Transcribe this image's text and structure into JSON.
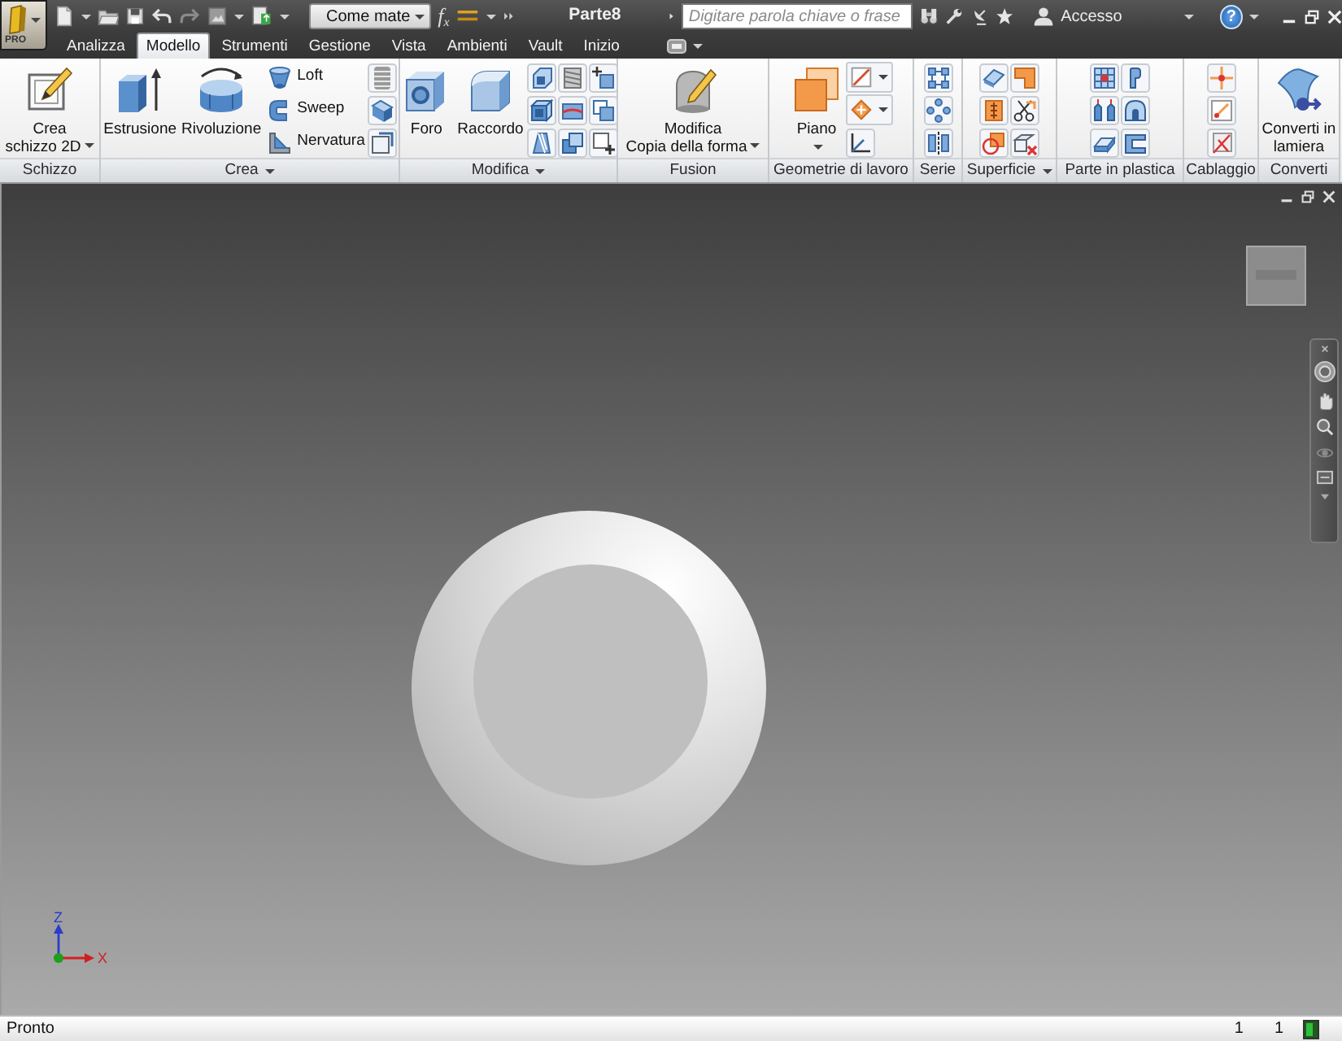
{
  "title_bar": {
    "app_edition": "PRO",
    "style_dropdown": "Come mate",
    "parameters": "f$_{x}$",
    "document_title": "Parte8",
    "search": {
      "placeholder": "Digitare parola chiave o frase"
    },
    "sign_in": "Accesso",
    "help": "?"
  },
  "tabs": [
    {
      "label": "Analizza",
      "selected": false
    },
    {
      "label": "Modello",
      "selected": true
    },
    {
      "label": "Strumenti",
      "selected": false
    },
    {
      "label": "Gestione",
      "selected": false
    },
    {
      "label": "Vista",
      "selected": false
    },
    {
      "label": "Ambienti",
      "selected": false
    },
    {
      "label": "Vault",
      "selected": false
    },
    {
      "label": "Inizio",
      "selected": false
    }
  ],
  "ribbon": {
    "panels": [
      {
        "title": "Schizzo",
        "menu": false,
        "tools": [
          {
            "kind": "large",
            "label": "Crea\nschizzo 2D",
            "menu": true
          }
        ]
      },
      {
        "title": "Crea",
        "menu": true,
        "tools": [
          {
            "kind": "large",
            "label": "Estrusione",
            "menu": false
          },
          {
            "kind": "large",
            "label": "Rivoluzione",
            "menu": false
          },
          {
            "kind": "small",
            "label": "Loft",
            "menu": false
          },
          {
            "kind": "small",
            "label": "Sweep",
            "menu": false
          },
          {
            "kind": "small",
            "label": "Nervatura",
            "menu": false
          },
          {
            "kind": "icon",
            "menu": false
          },
          {
            "kind": "icon",
            "menu": false
          },
          {
            "kind": "icon",
            "menu": false
          }
        ]
      },
      {
        "title": "Modifica",
        "menu": true,
        "tools": [
          {
            "kind": "large",
            "label": "Foro",
            "menu": false
          },
          {
            "kind": "large",
            "label": "Raccordo",
            "menu": false
          },
          {
            "kind": "icon",
            "menu": false
          },
          {
            "kind": "icon",
            "menu": false
          },
          {
            "kind": "icon",
            "menu": false
          },
          {
            "kind": "icon",
            "menu": false
          },
          {
            "kind": "icon",
            "menu": false
          },
          {
            "kind": "icon",
            "menu": false
          },
          {
            "kind": "icon",
            "menu": false
          },
          {
            "kind": "icon",
            "menu": false
          },
          {
            "kind": "icon",
            "menu": false
          }
        ]
      },
      {
        "title": "Fusion",
        "menu": false,
        "tools": [
          {
            "kind": "large",
            "label": "Modifica\nCopia della forma",
            "menu": true
          }
        ]
      },
      {
        "title": "Geometrie di lavoro",
        "menu": false,
        "tools": [
          {
            "kind": "large",
            "label": "Piano",
            "menu": true
          },
          {
            "kind": "icon",
            "menu": true
          },
          {
            "kind": "icon",
            "menu": true
          },
          {
            "kind": "icon",
            "menu": false
          }
        ]
      },
      {
        "title": "Serie",
        "menu": false,
        "tools": [
          {
            "kind": "icon",
            "menu": false
          },
          {
            "kind": "icon",
            "menu": false
          },
          {
            "kind": "icon",
            "menu": false
          }
        ]
      },
      {
        "title": "Superficie",
        "menu": true,
        "tools": [
          {
            "kind": "icon",
            "menu": false
          },
          {
            "kind": "icon",
            "menu": false
          },
          {
            "kind": "icon",
            "menu": false
          },
          {
            "kind": "icon",
            "menu": false
          },
          {
            "kind": "icon",
            "menu": false
          },
          {
            "kind": "icon",
            "menu": false
          }
        ]
      },
      {
        "title": "Parte in plastica",
        "menu": false,
        "tools": [
          {
            "kind": "icon",
            "menu": false
          },
          {
            "kind": "icon",
            "menu": false
          },
          {
            "kind": "icon",
            "menu": false
          },
          {
            "kind": "icon",
            "menu": false
          },
          {
            "kind": "icon",
            "menu": false
          },
          {
            "kind": "icon",
            "menu": false
          }
        ]
      },
      {
        "title": "Cablaggio",
        "menu": false,
        "tools": [
          {
            "kind": "icon",
            "menu": false
          },
          {
            "kind": "icon",
            "menu": false
          },
          {
            "kind": "icon",
            "menu": false
          }
        ]
      },
      {
        "title": "Converti",
        "menu": false,
        "tools": [
          {
            "kind": "large",
            "label": "Converti in\nlamiera",
            "menu": false
          }
        ]
      }
    ]
  },
  "viewport": {
    "triad": {
      "z_label": "Z",
      "x_label": "X"
    }
  },
  "status_bar": {
    "message": "Pronto",
    "field_1": "1",
    "field_2": "1"
  }
}
